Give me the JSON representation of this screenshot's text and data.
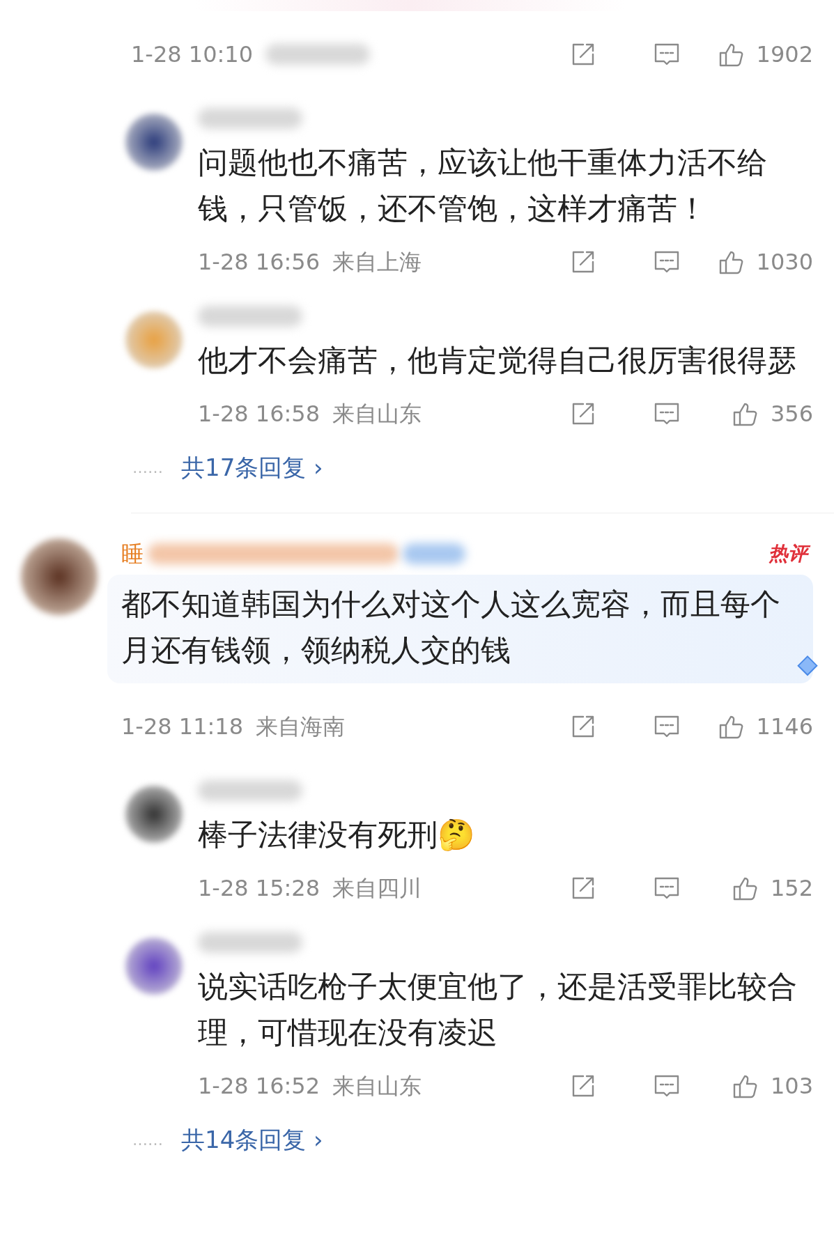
{
  "top_comment": {
    "time": "1-28 10:10",
    "replies": [
      {
        "text": "问题他也不痛苦，应该让他干重体力活不给钱，只管饭，还不管饱，这样才痛苦！",
        "time": "1-28 16:56",
        "location": "来自上海",
        "likes": "1030"
      },
      {
        "text": "他才不会痛苦，他肯定觉得自己很厉害很得瑟",
        "time": "1-28 16:58",
        "location": "来自山东",
        "likes": "356"
      }
    ],
    "more": {
      "dots": "……",
      "label": "共17条回复",
      "arrow": "›"
    },
    "likes": "1902"
  },
  "hot_comment": {
    "name": "睡",
    "hot_tag": "热评",
    "text": "都不知道韩国为什么对这个人这么宽容，而且每个月还有钱领，领纳税人交的钱",
    "time": "1-28 11:18",
    "location": "来自海南",
    "likes": "1146",
    "replies": [
      {
        "text": "棒子法律没有死刑🤔",
        "time": "1-28 15:28",
        "location": "来自四川",
        "likes": "152"
      },
      {
        "text": "说实话吃枪子太便宜他了，还是活受罪比较合理，可惜现在没有凌迟",
        "time": "1-28 16:52",
        "location": "来自山东",
        "likes": "103"
      }
    ],
    "more": {
      "dots": "……",
      "label": "共14条回复",
      "arrow": "›"
    }
  }
}
